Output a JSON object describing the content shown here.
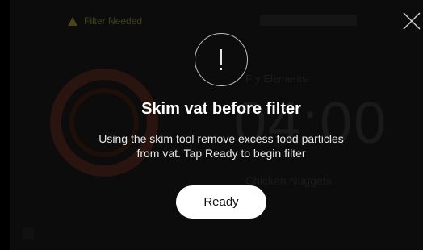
{
  "background": {
    "header_status": "Filter Needed",
    "mode_label": "Fry Elements",
    "timer_text": "04:00",
    "product_label": "Chicken Nuggets"
  },
  "modal": {
    "icon": "alert-icon",
    "title": "Skim vat before filter",
    "message_line1": "Using the skim tool remove excess food particles",
    "message_line2": "from vat. Tap Ready to begin filter",
    "ready_label": "Ready",
    "close_icon": "close-icon"
  },
  "colors": {
    "overlay": "#000000",
    "button_bg": "#ffffff",
    "button_text": "#111111"
  }
}
